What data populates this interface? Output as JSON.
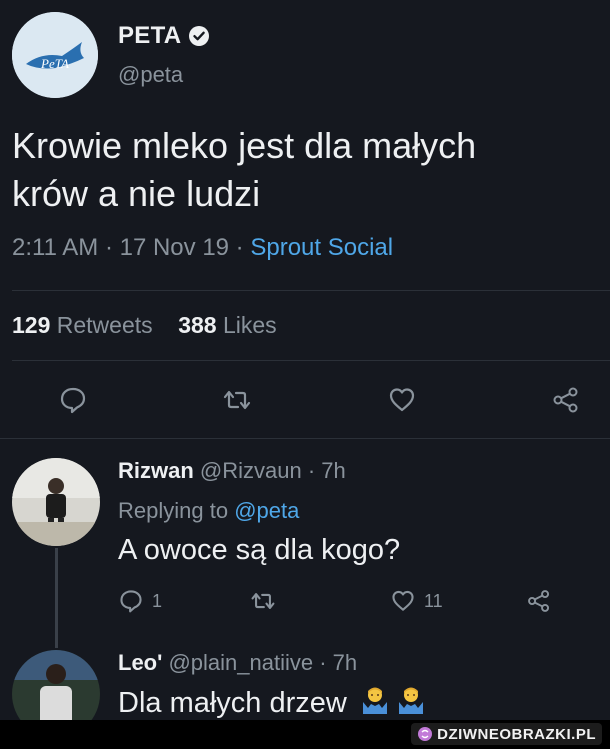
{
  "main_tweet": {
    "display_name": "PETA",
    "handle": "@peta",
    "text_line1": "Krowie mleko jest dla małych",
    "text_line2": "krów a nie ludzi",
    "time": "2:11 AM",
    "dot1": " · ",
    "date": "17 Nov 19",
    "dot2": " · ",
    "source": "Sprout Social",
    "retweets_count": "129",
    "retweets_label": "Retweets",
    "likes_count": "388",
    "likes_label": "Likes",
    "avatar_logo_text": "PeTA"
  },
  "reply1": {
    "name": "Rizwan",
    "handle": "@Rizvaun",
    "age": " · 7h",
    "replying_label": "Replying to ",
    "replying_to": "@peta",
    "text": "A owoce są dla kogo?",
    "reply_count": "1",
    "like_count": "11"
  },
  "reply2": {
    "name": "Leo'",
    "handle": "@plain_natiive",
    "age": " · 7h",
    "text": "Dla małych drzew"
  },
  "watermark": {
    "text": "DZIWNEOBRAZKI.PL"
  },
  "colors": {
    "background": "#15181f",
    "link": "#4fa7e8",
    "muted": "#8a939c"
  }
}
